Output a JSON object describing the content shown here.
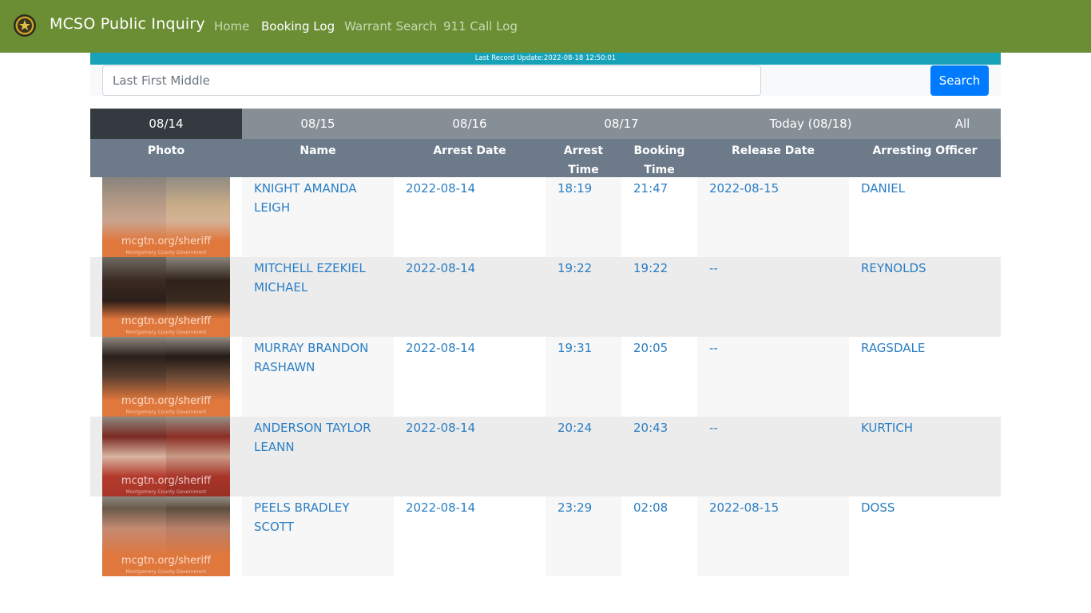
{
  "nav": {
    "brand": "MCSO Public Inquiry",
    "links": [
      "Home",
      "Booking Log",
      "Warrant Search",
      "911 Call Log"
    ],
    "active": "Booking Log"
  },
  "update_text": "Last Record Update:2022-08-18 12:50:01",
  "search": {
    "placeholder": "Last First Middle",
    "button_label": "Search"
  },
  "tabs": [
    "08/14",
    "08/15",
    "08/16",
    "08/17",
    "Today (08/18)",
    "All"
  ],
  "active_tab": "08/14",
  "columns": {
    "photo": "Photo",
    "name": "Name",
    "arrest_date": "Arrest Date",
    "arrest_time_1": "Arrest",
    "arrest_time_2": "Time",
    "booking_time_1": "Booking",
    "booking_time_2": "Time",
    "release_date": "Release Date",
    "officer": "Arresting Officer"
  },
  "photo_watermark": "mcgtn.org/sheriff",
  "photo_watermark_sub": "Montgomery County Government",
  "rows": [
    {
      "name_1": "KNIGHT AMANDA",
      "name_2": "LEIGH",
      "arrest_date": "2022-08-14",
      "arrest_time": "18:19",
      "booking_time": "21:47",
      "release_date": "2022-08-15",
      "officer": "DANIEL"
    },
    {
      "name_1": "MITCHELL EZEKIEL",
      "name_2": "MICHAEL",
      "arrest_date": "2022-08-14",
      "arrest_time": "19:22",
      "booking_time": "19:22",
      "release_date": "--",
      "officer": "REYNOLDS"
    },
    {
      "name_1": "MURRAY BRANDON",
      "name_2": "RASHAWN",
      "arrest_date": "2022-08-14",
      "arrest_time": "19:31",
      "booking_time": "20:05",
      "release_date": "--",
      "officer": "RAGSDALE"
    },
    {
      "name_1": "ANDERSON TAYLOR",
      "name_2": "LEANN",
      "arrest_date": "2022-08-14",
      "arrest_time": "20:24",
      "booking_time": "20:43",
      "release_date": "--",
      "officer": "KURTICH"
    },
    {
      "name_1": "PEELS BRADLEY",
      "name_2": "SCOTT",
      "arrest_date": "2022-08-14",
      "arrest_time": "23:29",
      "booking_time": "02:08",
      "release_date": "2022-08-15",
      "officer": "DOSS"
    }
  ]
}
